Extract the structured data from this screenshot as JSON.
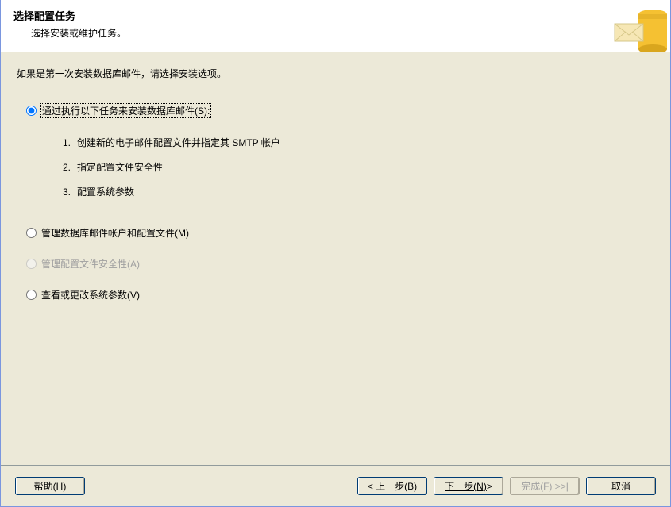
{
  "header": {
    "title": "选择配置任务",
    "subtitle": "选择安装或维护任务。"
  },
  "intro": "如果是第一次安装数据库邮件，请选择安装选项。",
  "options": {
    "install": {
      "label": "通过执行以下任务来安装数据库邮件(S):",
      "selected": true,
      "sub": [
        "创建新的电子邮件配置文件并指定其 SMTP 帐户",
        "指定配置文件安全性",
        "配置系统参数"
      ]
    },
    "manage": {
      "label": "管理数据库邮件帐户和配置文件(M)",
      "selected": false
    },
    "security": {
      "label": "管理配置文件安全性(A)",
      "selected": false,
      "disabled": true
    },
    "params": {
      "label": "查看或更改系统参数(V)",
      "selected": false
    }
  },
  "buttons": {
    "help": "帮助(H)",
    "back": "< 上一步(B)",
    "next_a": "下一步(N)",
    "next_b": " >",
    "finish": "完成(F) >>|",
    "cancel": "取消"
  }
}
